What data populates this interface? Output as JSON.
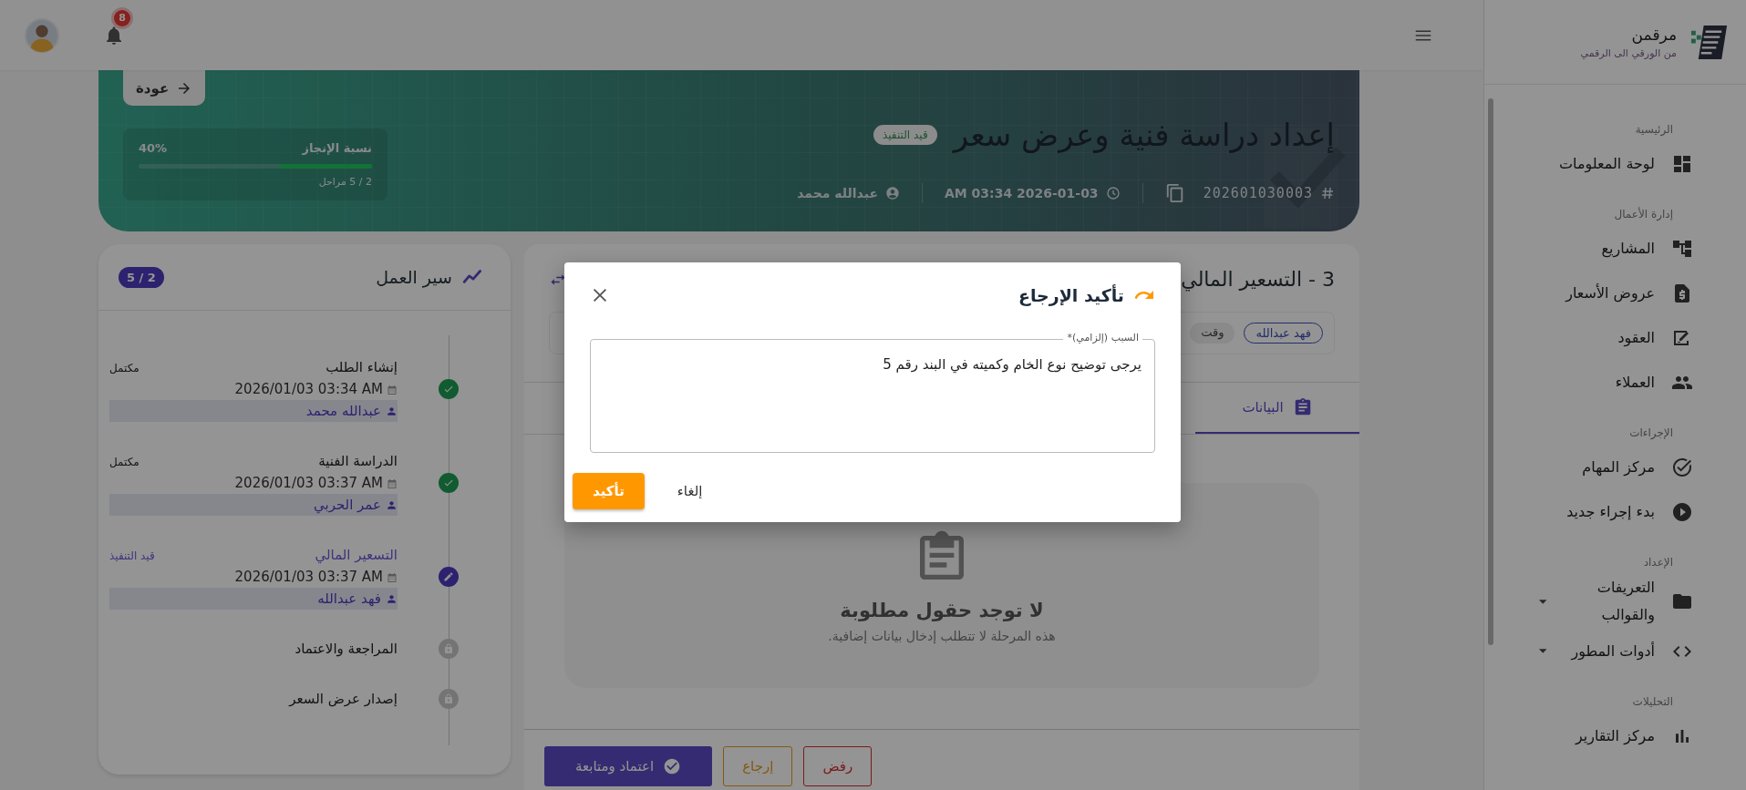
{
  "sidebar": {
    "brand": {
      "name": "مرقمن",
      "tagline": "من الورقي الى الرقمي"
    },
    "sections": [
      {
        "label": "الرئيسية",
        "items": [
          {
            "label": "لوحة المعلومات"
          }
        ]
      },
      {
        "label": "إدارة الأعمال",
        "items": [
          {
            "label": "المشاريع"
          },
          {
            "label": "عروض الأسعار"
          },
          {
            "label": "العقود"
          },
          {
            "label": "العملاء"
          }
        ]
      },
      {
        "label": "الإجراءات",
        "items": [
          {
            "label": "مركز المهام"
          },
          {
            "label": "بدء إجراء جديد"
          }
        ]
      },
      {
        "label": "الإعداد",
        "items": [
          {
            "label": "التعريفات والقوالب",
            "expanded": false
          },
          {
            "label": "أدوات المطور",
            "expanded": false
          }
        ]
      },
      {
        "label": "التحليلات",
        "items": [
          {
            "label": "مركز التقارير"
          }
        ]
      }
    ]
  },
  "topbar": {
    "notification_count": "8"
  },
  "banner": {
    "back_label": "عودة",
    "title": "إعداد دراسة فنية وعرض سعر",
    "status": "قيد التنفيذ",
    "request_number": "202601030003",
    "created_at": "2026-01-03 03:34 AM",
    "created_by": "عبدالله محمد",
    "progress": {
      "label": "نسبة الإنجاز",
      "percent": "40%",
      "level": 0.4,
      "steps": "2 / 5 مراحل"
    }
  },
  "stage": {
    "title": "3 - التسعير المالي",
    "assignee": "فهد عبدالله",
    "time_chip": "وقت",
    "tabs": [
      {
        "label": "البيانات",
        "selected": true
      }
    ],
    "empty": {
      "title": "لا توجد حقول مطلوبة",
      "text": "هذه المرحلة لا تتطلب إدخال بيانات إضافية."
    },
    "actions": [
      {
        "kind": "danger",
        "label": "رفض"
      },
      {
        "kind": "warning",
        "label": "إرجاع"
      },
      {
        "kind": "primary",
        "label": "اعتماد ومتابعة"
      }
    ]
  },
  "workflow": {
    "title": "سير العمل",
    "count": "2 / 5",
    "steps": [
      {
        "kind": "done",
        "title": "إنشاء الطلب",
        "status": "مكتمل",
        "date": "2026/01/03 03:34 AM",
        "user": "عبدالله محمد"
      },
      {
        "kind": "done",
        "title": "الدراسة الفنية",
        "status": "مكتمل",
        "date": "2026/01/03 03:37 AM",
        "user": "عمر الحربي"
      },
      {
        "kind": "current",
        "title": "التسعير المالي",
        "status": "قيد التنفيذ",
        "date": "2026/01/03 03:37 AM",
        "user": "فهد عبدالله"
      },
      {
        "kind": "locked",
        "title": "المراجعة والاعتماد"
      },
      {
        "kind": "locked",
        "title": "إصدار عرض السعر"
      }
    ]
  },
  "modal": {
    "title": "تأكيد الإرجاع",
    "field": {
      "label": "السبب (إلزامي)*",
      "value": "يرجى توضيح نوع الخام وكميته في البند رقم 5"
    },
    "buttons": [
      {
        "kind": "cancel",
        "label": "إلغاء"
      },
      {
        "kind": "confirm",
        "label": "تأكيد"
      }
    ]
  }
}
